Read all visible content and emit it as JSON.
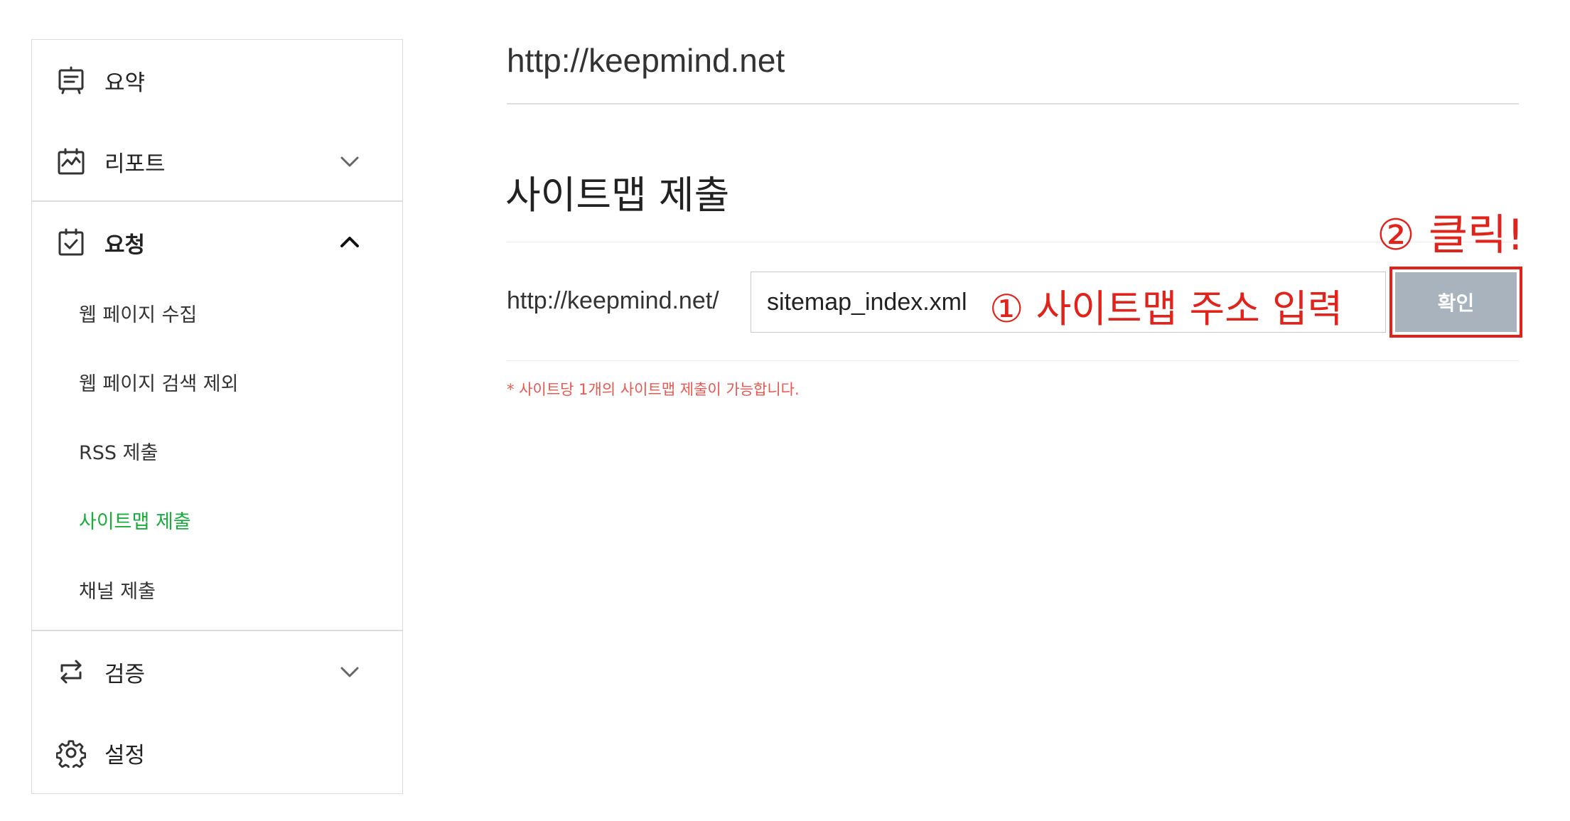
{
  "sidebar": {
    "items": [
      {
        "label": "요약",
        "icon": "summary-board-icon"
      },
      {
        "label": "리포트",
        "icon": "report-chart-icon",
        "chevron": "chevron-down-icon"
      },
      {
        "label": "요청",
        "icon": "request-check-icon",
        "chevron": "chevron-up-icon",
        "expanded": true
      },
      {
        "label": "검증",
        "icon": "verify-arrows-icon",
        "chevron": "chevron-down-icon"
      },
      {
        "label": "설정",
        "icon": "gear-icon"
      }
    ],
    "subitems": [
      {
        "label": "웹 페이지 수집"
      },
      {
        "label": "웹 페이지 검색 제외"
      },
      {
        "label": "RSS 제출"
      },
      {
        "label": "사이트맵 제출",
        "active": true
      },
      {
        "label": "채널 제출"
      }
    ],
    "active_color": "#1aad3b"
  },
  "main": {
    "site_url": "http://keepmind.net",
    "section_title": "사이트맵 제출",
    "prefix": "http://keepmind.net/",
    "input_value": "sitemap_index.xml",
    "confirm_label": "확인",
    "notice": "* 사이트당 1개의 사이트맵 제출이 가능합니다."
  },
  "annotations": {
    "step1": "① 사이트맵 주소 입력",
    "step2": "② 클릭!",
    "color": "#e0241c"
  }
}
